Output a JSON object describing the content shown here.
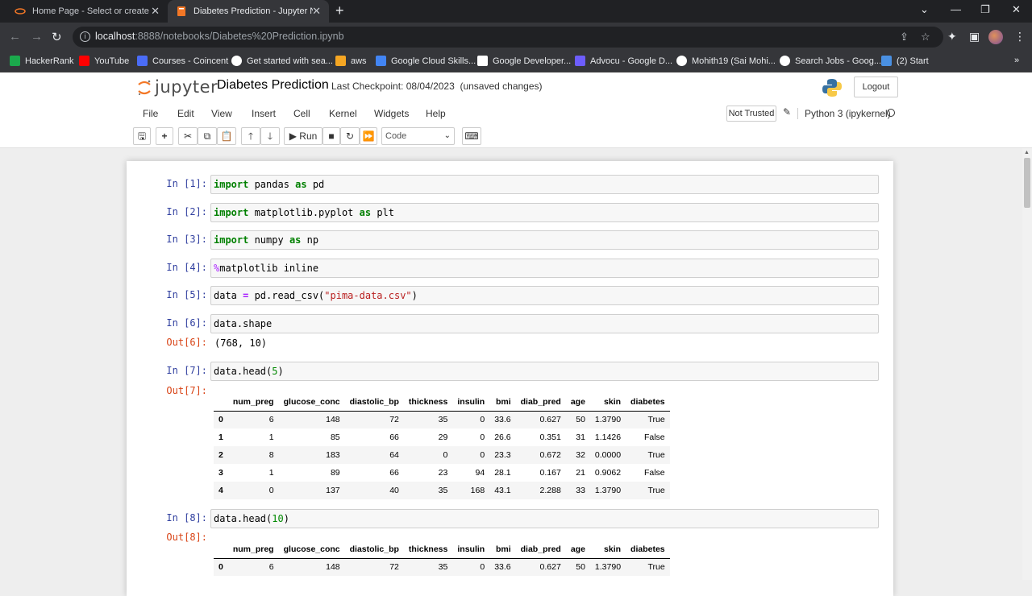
{
  "browser": {
    "tabs": [
      {
        "title": "Home Page - Select or create a n",
        "active": false
      },
      {
        "title": "Diabetes Prediction - Jupyter No",
        "active": true
      }
    ],
    "url_host": "localhost",
    "url_path": ":8888/notebooks/Diabetes%20Prediction.ipynb",
    "bookmarks": [
      {
        "label": "HackerRank",
        "icon": "hackerrank-icon",
        "color": "#1ba94c"
      },
      {
        "label": "YouTube",
        "icon": "youtube-icon",
        "color": "#ff0000"
      },
      {
        "label": "Courses - Coincent",
        "icon": "coincent-icon",
        "color": "#4a6cf7"
      },
      {
        "label": "Get started with sea...",
        "icon": "google-icon",
        "color": "#ffffff"
      },
      {
        "label": "aws",
        "icon": "aws-icon",
        "color": "#f5a623"
      },
      {
        "label": "Google Cloud Skills...",
        "icon": "google-cloud-icon",
        "color": "#4285f4"
      },
      {
        "label": "Google Developer...",
        "icon": "google-developers-icon",
        "color": "#ffffff"
      },
      {
        "label": "Advocu - Google D...",
        "icon": "advocu-icon",
        "color": "#6d5dfc"
      },
      {
        "label": "Mohith19 (Sai Mohi...",
        "icon": "github-icon",
        "color": "#ffffff"
      },
      {
        "label": "Search Jobs - Goog...",
        "icon": "google-icon",
        "color": "#ffffff"
      },
      {
        "label": "(2) Start",
        "icon": "start-icon",
        "color": "#4a90e2"
      }
    ]
  },
  "jupyter": {
    "logo_text": "jupyter",
    "notebook_title": "Diabetes Prediction",
    "checkpoint": "Last Checkpoint: 08/04/2023",
    "unsaved": "(unsaved changes)",
    "logout_label": "Logout",
    "menus": [
      "File",
      "Edit",
      "View",
      "Insert",
      "Cell",
      "Kernel",
      "Widgets",
      "Help"
    ],
    "trust_label": "Not Trusted",
    "kernel_name": "Python 3 (ipykernel)",
    "run_label": "Run",
    "cell_type": "Code"
  },
  "cells": {
    "c1": {
      "prompt": "In [1]:"
    },
    "c2": {
      "prompt": "In [2]:"
    },
    "c3": {
      "prompt": "In [3]:"
    },
    "c4": {
      "prompt": "In [4]:"
    },
    "c5": {
      "prompt": "In [5]:"
    },
    "c6": {
      "prompt": "In [6]:",
      "out_prompt": "Out[6]:",
      "output": "(768, 10)"
    },
    "c7": {
      "prompt": "In [7]:",
      "out_prompt": "Out[7]:"
    },
    "c8": {
      "prompt": "In [8]:",
      "out_prompt": "Out[8]:"
    }
  },
  "dataframe": {
    "columns": [
      "num_preg",
      "glucose_conc",
      "diastolic_bp",
      "thickness",
      "insulin",
      "bmi",
      "diab_pred",
      "age",
      "skin",
      "diabetes"
    ],
    "rows": [
      [
        "0",
        "6",
        "148",
        "72",
        "35",
        "0",
        "33.6",
        "0.627",
        "50",
        "1.3790",
        "True"
      ],
      [
        "1",
        "1",
        "85",
        "66",
        "29",
        "0",
        "26.6",
        "0.351",
        "31",
        "1.1426",
        "False"
      ],
      [
        "2",
        "8",
        "183",
        "64",
        "0",
        "0",
        "23.3",
        "0.672",
        "32",
        "0.0000",
        "True"
      ],
      [
        "3",
        "1",
        "89",
        "66",
        "23",
        "94",
        "28.1",
        "0.167",
        "21",
        "0.9062",
        "False"
      ],
      [
        "4",
        "0",
        "137",
        "40",
        "35",
        "168",
        "43.1",
        "2.288",
        "33",
        "1.3790",
        "True"
      ]
    ]
  },
  "colors": {
    "in_prompt": "#303f9f",
    "out_prompt": "#d84315",
    "keyword": "#008000",
    "string": "#ba2121"
  }
}
